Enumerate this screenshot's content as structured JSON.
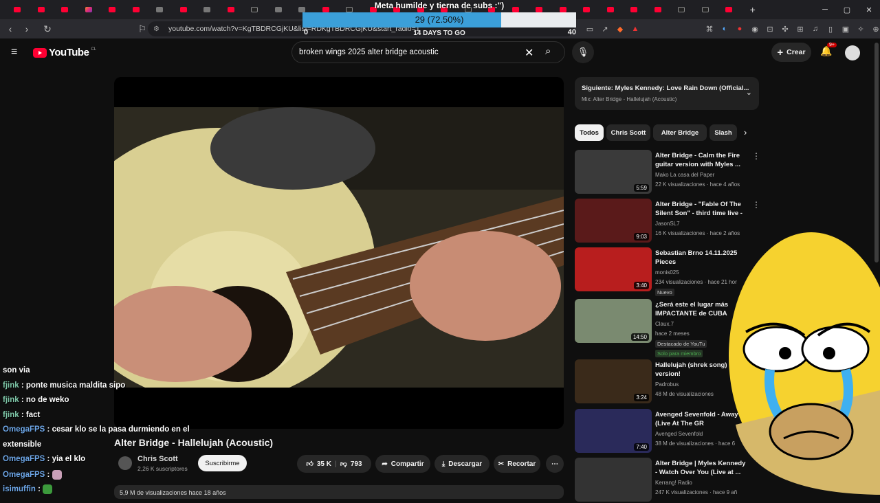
{
  "browser": {
    "url": "youtube.com/watch?v=KgTBDRCGjKU&list=RDKgTBDRCGjKU&start_radio=1"
  },
  "goal": {
    "title": "Meta humilde y tierna de subs :\")",
    "current": 29,
    "target": 40,
    "start": 0,
    "fraction": 0.725,
    "pct_label": "29 (72.50%)",
    "min_label": "0",
    "max_label": "40",
    "days_label": "14 DAYS TO GO"
  },
  "header": {
    "logo": "YouTube",
    "country": "CL",
    "search_query": "broken wings 2025 alter bridge acoustic",
    "create_label": "Crear",
    "notif_badge": "9+"
  },
  "video": {
    "title": "Alter Bridge - Hallelujah (Acoustic)",
    "channel": "Chris Scott",
    "subscribers": "2,26 K suscriptores",
    "subscribe_label": "Suscribirme",
    "likes": "35 K",
    "dislikes": "793",
    "share_label": "Compartir",
    "download_label": "Descargar",
    "clip_label": "Recortar",
    "views_line": "5,9 M de visualizaciones  hace 18 años"
  },
  "chat": [
    {
      "user": "",
      "text": "son via"
    },
    {
      "user": "fjink",
      "text": " : ponte musica maldita sipo"
    },
    {
      "user": "fjink",
      "text": " : no de weko"
    },
    {
      "user": "fjink",
      "text": " : fact"
    },
    {
      "user": "OmegaFPS",
      "text": " : cesar klo se la pasa durmiendo en el"
    },
    {
      "user": "",
      "text": "extensible"
    },
    {
      "user": "OmegaFPS",
      "text": " : yia el klo"
    },
    {
      "user": "OmegaFPS",
      "text": " : "
    },
    {
      "user": "isimuffin",
      "text": " : "
    }
  ],
  "sidebar": {
    "next_title": "Siguiente: Myles Kennedy: Love Rain Down (Official...",
    "next_sub": "Mix: Alter Bridge - Hallelujah (Acoustic)",
    "chips": [
      "Todos",
      "Chris Scott",
      "Alter Bridge",
      "Slash"
    ],
    "recs": [
      {
        "title": "Alter Bridge - Calm the Fire guitar version with Myles ...",
        "channel": "Mako La casa del Paper",
        "stats": "22 K visualizaciones · hace 4 años",
        "duration": "5:59"
      },
      {
        "title": "Alter Bridge - \"Fable Of The Silent Son\" - third time live - ...",
        "channel": "JasonSL7",
        "stats": "16 K visualizaciones · hace 2 años",
        "duration": "9:03"
      },
      {
        "title": "Sebastian Brno 14.11.2025 Pieces",
        "channel": "monis025",
        "stats": "234 visualizaciones · hace 21 hor",
        "duration": "3:40",
        "tag": "Nuevo"
      },
      {
        "title": "¿Será este el lugar más IMPACTANTE de CUBA",
        "channel": "Claux.7",
        "stats": "hace 2 meses",
        "duration": "14:50",
        "tag": "Destacado de YouTu",
        "tag2": "Solo para miembro"
      },
      {
        "title": "Hallelujah (shrek song) version!",
        "channel": "Padrobus",
        "stats": "48 M de visualizaciones",
        "duration": "3:24"
      },
      {
        "title": "Avenged Sevenfold - Away (Live At The GR",
        "channel": "Avenged Sevenfold",
        "stats": "38 M de visualizaciones · hace 6",
        "duration": "7:40"
      },
      {
        "title": "Alter Bridge | Myles Kennedy - Watch Over You (Live at ...",
        "channel": "Kerrang! Radio",
        "stats": "247 K visualizaciones · hace 9 añ",
        "duration": ""
      }
    ]
  },
  "icons": [
    "back-icon",
    "forward-icon",
    "reload-icon",
    "bookmark-icon",
    "menu-icon",
    "search-icon",
    "clear-icon",
    "mic-icon",
    "plus-icon",
    "bell-icon",
    "like-icon",
    "dislike-icon",
    "share-icon",
    "download-icon",
    "scissors-icon",
    "more-icon",
    "chevron-down-icon",
    "chevron-right-icon",
    "kebab-icon"
  ],
  "colors": {
    "brand": "#ff0033",
    "goal_fill": "#3b9fd9",
    "bg": "#0f0f0f"
  }
}
